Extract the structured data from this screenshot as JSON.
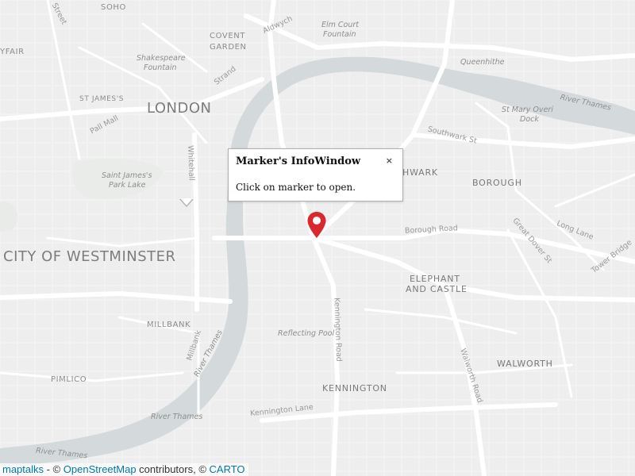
{
  "map": {
    "labels": {
      "soho": "SOHO",
      "mayfair": "YFAIR",
      "covent_garden_1": "COVENT",
      "covent_garden_2": "GARDEN",
      "elm_court_1": "Elm Court",
      "elm_court_2": "Fountain",
      "shakespeare_1": "Shakespeare",
      "shakespeare_2": "Fountain",
      "st_james": "ST JAMES'S",
      "london": "LONDON",
      "queenhithe": "Queenhithe",
      "river_thames_ne": "River Thames",
      "st_mary_1": "St Mary Overi",
      "st_mary_2": "Dock",
      "southwark_street": "Southwark St",
      "southwark": "HWARK",
      "borough": "BOROUGH",
      "st_james_park_1": "Saint James's",
      "st_james_park_2": "Park Lake",
      "westminster": "CITY OF WESTMINSTER",
      "elephant_1": "ELEPHANT",
      "elephant_2": "AND CASTLE",
      "millbank": "MILLBANK",
      "reflecting_pool": "Reflecting Pool",
      "walworth": "WALWORTH",
      "pimlico": "PIMLICO",
      "kennington": "KENNINGTON",
      "river_thames_sw": "River Thames",
      "river_thames_s": "River Thames",
      "river_thames_sw2": "River Thames",
      "kennington_lane": "Kennington Lane",
      "kennington_road": "Kennington Road",
      "walworth_road": "Walworth Road",
      "borough_road": "Borough Road",
      "long_lane": "Long Lane",
      "great_dover": "Great Dover St",
      "tower_bridge": "Tower Bridge",
      "whitehall": "Whitehall",
      "pall_mall": "Pall Mall",
      "strand": "Strand",
      "aldwych": "Aldwych",
      "millbank_road": "Millbank",
      "street_frag": "Street"
    }
  },
  "infowindow": {
    "title": "Marker's InfoWindow",
    "close": "×",
    "content": "Click on marker to open."
  },
  "marker": {
    "color": "#d9282f",
    "icon": "map-pin-icon"
  },
  "attribution": {
    "maptalks": "maptalks",
    "sep": " - © ",
    "osm": "OpenStreetMap",
    "contrib": " contributors, © ",
    "carto": "CARTO"
  },
  "colors": {
    "land": "#f2f2f2",
    "water": "#d4dadc",
    "road": "#ffffff",
    "park": "#e8ebe8"
  }
}
